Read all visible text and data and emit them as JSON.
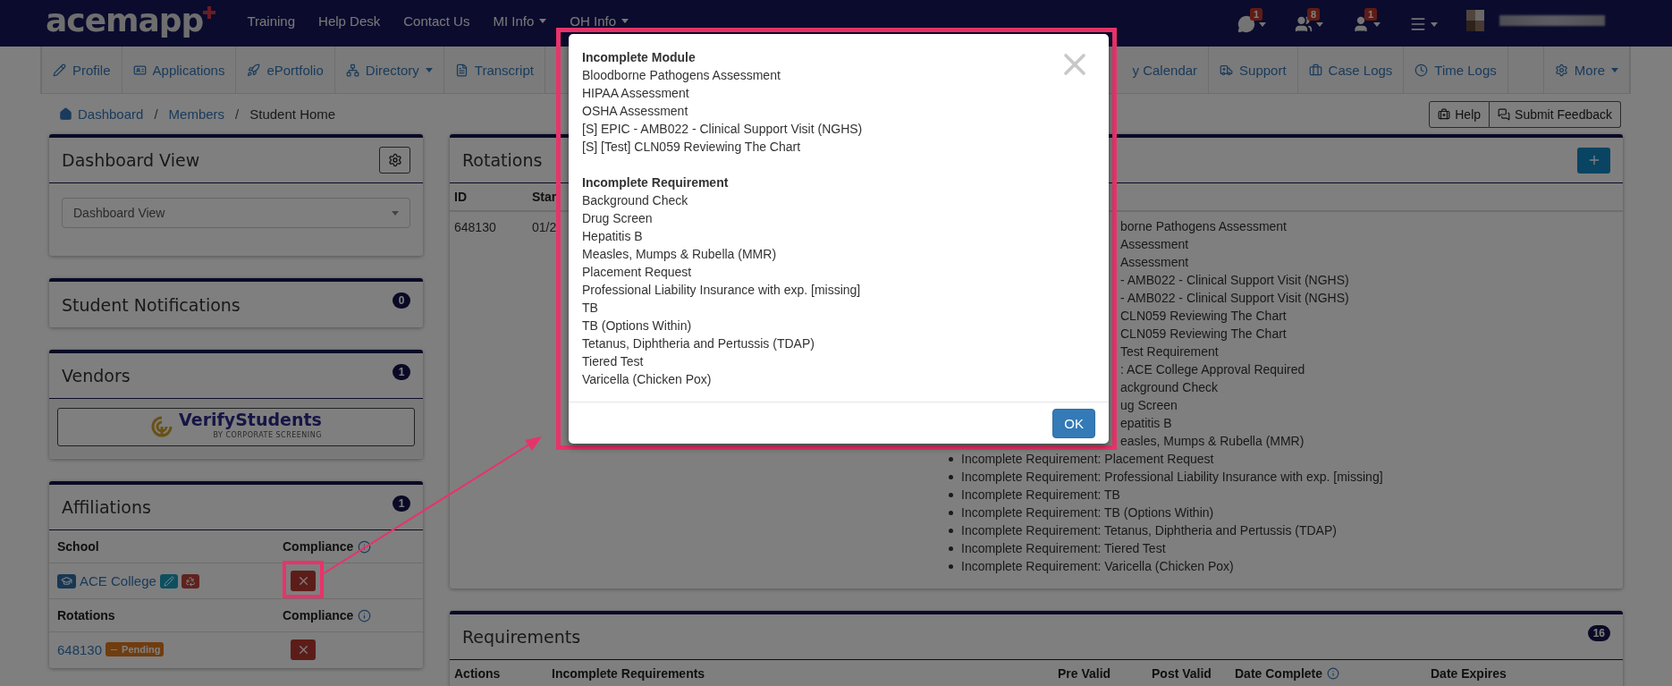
{
  "navbar": {
    "logo": "acemapp",
    "links": [
      {
        "label": "Training",
        "dropdown": false
      },
      {
        "label": "Help Desk",
        "dropdown": false
      },
      {
        "label": "Contact Us",
        "dropdown": false
      },
      {
        "label": "MI Info",
        "dropdown": true
      },
      {
        "label": "OH Info",
        "dropdown": true
      }
    ],
    "alerts": [
      {
        "kind": "chat",
        "count": "1"
      },
      {
        "kind": "group",
        "count": "8"
      },
      {
        "kind": "user",
        "count": "1"
      },
      {
        "kind": "menu"
      }
    ]
  },
  "subnav": {
    "left": [
      {
        "label": "Profile",
        "dropdown": false
      },
      {
        "label": "Applications",
        "dropdown": false
      },
      {
        "label": "ePortfolio",
        "dropdown": false
      },
      {
        "label": "Directory",
        "dropdown": true
      },
      {
        "label": "Transcript",
        "dropdown": false
      }
    ],
    "right": [
      {
        "kind": "cut",
        "label": "y Calendar",
        "dropdown": false
      },
      {
        "kind": "support",
        "label": "Support",
        "dropdown": false
      },
      {
        "kind": "cases",
        "label": "Case Logs",
        "dropdown": false
      },
      {
        "kind": "time",
        "label": "Time Logs",
        "dropdown": false
      },
      {
        "kind": "blank"
      },
      {
        "kind": "more",
        "label": "More",
        "dropdown": true
      }
    ]
  },
  "breadcrumb": {
    "items": [
      "Dashboard",
      "Members",
      "Student Home"
    ],
    "separator": "/"
  },
  "page_buttons": [
    {
      "kind": "help",
      "label": "Help"
    },
    {
      "kind": "feedback",
      "label": "Submit Feedback"
    }
  ],
  "dashboard_view": {
    "title": "Dashboard View",
    "select": {
      "value": "Dashboard View"
    }
  },
  "student_notifications": {
    "title": "Student Notifications",
    "count": "0"
  },
  "vendors": {
    "title": "Vendors",
    "count": "1",
    "vendor": {
      "name": "VerifyStudents",
      "tagline": "BY CORPORATE SCREENING"
    }
  },
  "affiliations": {
    "title": "Affiliations",
    "count": "1",
    "school_header": "School",
    "compliance_header": "Compliance",
    "school": "ACE College",
    "school_compliant": false,
    "rotations_header": "Rotations",
    "rotation_compliance_header": "Compliance",
    "rotation_id": "648130",
    "rotation_status": "Pending",
    "rotation_compliant": false
  },
  "rotations": {
    "title": "Rotations",
    "columns": [
      "ID",
      "Star"
    ],
    "rows": [
      {
        "id": "648130",
        "start": "01/2",
        "partly_covered_items": [
          "borne Pathogens Assessment",
          "Assessment",
          "Assessment",
          "- AMB022 - Clinical Support Visit (NGHS)",
          "- AMB022 - Clinical Support Visit (NGHS)",
          "CLN059 Reviewing The Chart",
          "CLN059 Reviewing The Chart",
          "Test Requirement",
          ": ACE College Approval Required",
          "ackground Check",
          "ug Screen",
          "epatitis B",
          "easles, Mumps & Rubella (MMR)"
        ],
        "items": [
          "Incomplete Requirement: Placement Request",
          "Incomplete Requirement: Professional Liability Insurance with exp. [missing]",
          "Incomplete Requirement: TB",
          "Incomplete Requirement: TB (Options Within)",
          "Incomplete Requirement: Tetanus, Diphtheria and Pertussis (TDAP)",
          "Incomplete Requirement: Tiered Test",
          "Incomplete Requirement: Varicella (Chicken Pox)"
        ]
      }
    ]
  },
  "requirements": {
    "title": "Requirements",
    "count": "16",
    "columns": [
      {
        "label": "Actions",
        "info": false
      },
      {
        "label": "Incomplete Requirements",
        "info": false
      },
      {
        "label": "Pre Valid",
        "info": false
      },
      {
        "label": "Post Valid",
        "info": false
      },
      {
        "label": "Date Complete",
        "info": true
      },
      {
        "label": "Date Expires",
        "info": false
      }
    ]
  },
  "modal": {
    "sections": [
      {
        "heading": "Incomplete Module",
        "items": [
          "Bloodborne Pathogens Assessment",
          "HIPAA Assessment",
          "OSHA Assessment",
          "[S] EPIC - AMB022 - Clinical Support Visit (NGHS)",
          "[S] [Test] CLN059 Reviewing The Chart"
        ]
      },
      {
        "heading": "Incomplete Requirement",
        "items": [
          "Background Check",
          "Drug Screen",
          "Hepatitis B",
          "Measles, Mumps & Rubella (MMR)",
          "Placement Request",
          "Professional Liability Insurance with exp. [missing]",
          "TB",
          "TB (Options Within)",
          "Tetanus, Diphtheria and Pertussis (TDAP)",
          "Tiered Test",
          "Varicella (Chicken Pox)"
        ]
      }
    ],
    "ok_label": "OK"
  }
}
